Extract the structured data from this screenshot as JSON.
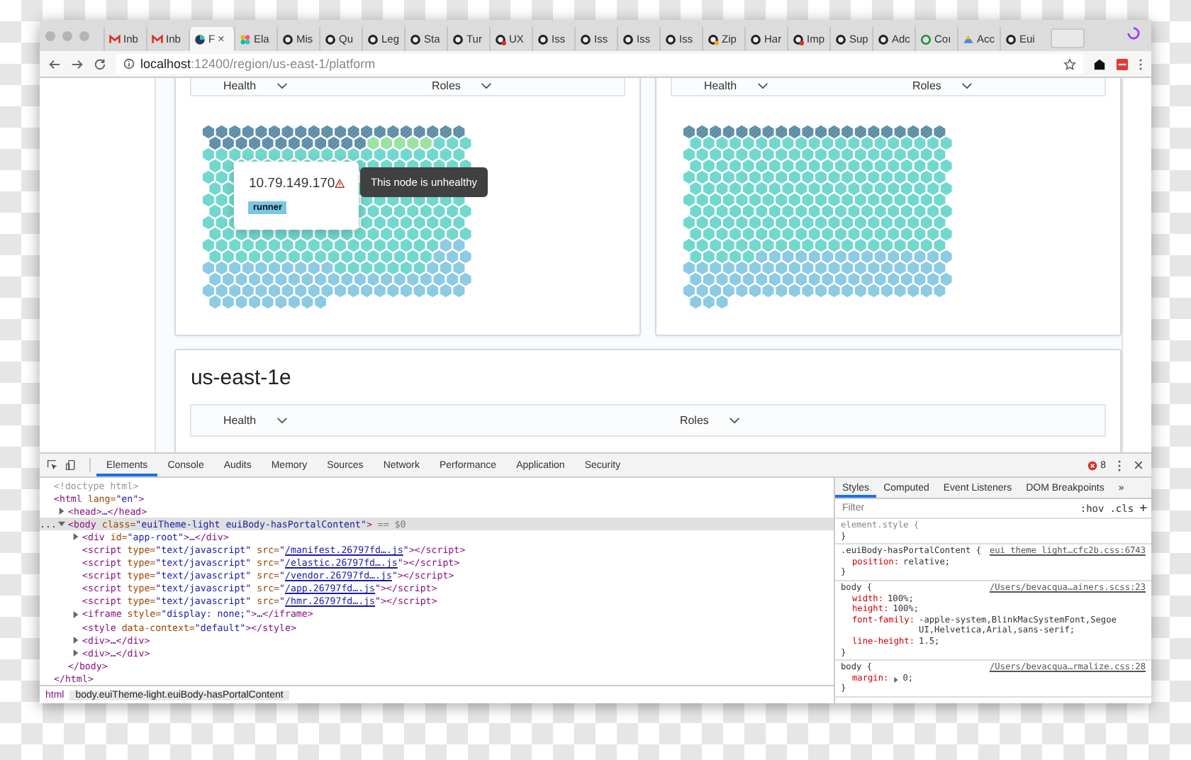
{
  "browser": {
    "tabs": [
      {
        "kind": "mail",
        "label": "Inb",
        "selected": false
      },
      {
        "kind": "mail",
        "label": "Inb",
        "selected": false
      },
      {
        "kind": "app",
        "label": "F",
        "selected": true,
        "close": "×"
      },
      {
        "kind": "elastic",
        "label": "Ela",
        "selected": false
      },
      {
        "kind": "github",
        "label": "Mis",
        "selected": false
      },
      {
        "kind": "github",
        "label": "Qu",
        "selected": false
      },
      {
        "kind": "github",
        "label": "Leg",
        "selected": false
      },
      {
        "kind": "github",
        "label": "Sta",
        "selected": false
      },
      {
        "kind": "github",
        "label": "Tur",
        "selected": false
      },
      {
        "kind": "github-error",
        "label": "UX",
        "selected": false
      },
      {
        "kind": "github",
        "label": "Iss",
        "selected": false
      },
      {
        "kind": "github",
        "label": "Iss",
        "selected": false
      },
      {
        "kind": "github",
        "label": "Iss",
        "selected": false
      },
      {
        "kind": "github",
        "label": "Iss",
        "selected": false
      },
      {
        "kind": "github-pending",
        "label": "Zip",
        "selected": false
      },
      {
        "kind": "github",
        "label": "Har",
        "selected": false
      },
      {
        "kind": "github-error",
        "label": "Imp",
        "selected": false
      },
      {
        "kind": "github",
        "label": "Sup",
        "selected": false
      },
      {
        "kind": "github",
        "label": "Adc",
        "selected": false
      },
      {
        "kind": "github-ok",
        "label": "Coı",
        "selected": false
      },
      {
        "kind": "drive",
        "label": "Acc",
        "selected": false
      },
      {
        "kind": "github",
        "label": "Eui",
        "selected": false
      }
    ],
    "address": {
      "host": "localhost",
      "path": ":12400/region/us-east-1/platform"
    }
  },
  "page": {
    "zones": [
      {
        "filters": [
          {
            "label": "Health"
          },
          {
            "label": "Roles"
          }
        ],
        "popover": {
          "ip": "10.79.149.170",
          "role": "runner",
          "tooltip": "This node is unhealthy"
        }
      },
      {
        "filters": [
          {
            "label": "Health"
          },
          {
            "label": "Roles"
          }
        ]
      }
    ],
    "section": {
      "title": "us-east-1e",
      "filters": [
        {
          "label": "Health"
        },
        {
          "label": "Roles"
        }
      ]
    }
  },
  "devtools": {
    "tabs": [
      {
        "label": "Elements",
        "selected": true
      },
      {
        "label": "Console",
        "selected": false
      },
      {
        "label": "Audits",
        "selected": false
      },
      {
        "label": "Memory",
        "selected": false
      },
      {
        "label": "Sources",
        "selected": false
      },
      {
        "label": "Network",
        "selected": false
      },
      {
        "label": "Performance",
        "selected": false
      },
      {
        "label": "Application",
        "selected": false
      },
      {
        "label": "Security",
        "selected": false
      }
    ],
    "error_count": "8",
    "dom": [
      {
        "text": "<!doctype html>",
        "kind": "doctype"
      },
      {
        "text": "<html lang=\"en\">",
        "close": "</html>",
        "children": [
          {
            "text": "<head>…</head>",
            "expanded": false
          },
          {
            "text": "<body class=\"euiTheme-light euiBody-hasPortalContent\">",
            "marker": "...",
            "suffix": "== $0",
            "selected": true,
            "expanded": true,
            "close": "</body>",
            "children": [
              {
                "text": "<div id=\"app-root\">…</div>",
                "expanded": false
              },
              {
                "text": "<script type=\"text/javascript\" src=\"",
                "link": "/manifest.26797fd….js",
                "after": "\"></script>"
              },
              {
                "text": "<script type=\"text/javascript\" src=\"",
                "link": "/elastic.26797fd….js",
                "after": "\"></script>"
              },
              {
                "text": "<script type=\"text/javascript\" src=\"",
                "link": "/vendor.26797fd….js",
                "after": "\"></script>"
              },
              {
                "text": "<script type=\"text/javascript\" src=\"",
                "link": "/app.26797fd….js",
                "after": "\"></script>"
              },
              {
                "text": "<script type=\"text/javascript\" src=\"",
                "link": "/hmr.26797fd….js",
                "after": "\"></script>"
              },
              {
                "text": "<iframe style=\"display: none;\">…</iframe>",
                "expanded": false
              },
              {
                "text": "<style data-context=\"default\"></style>"
              },
              {
                "text": "<div>…</div>",
                "expanded": false
              },
              {
                "text": "<div>…</div>",
                "expanded": false
              }
            ]
          }
        ]
      }
    ],
    "breadcrumbs": [
      {
        "label": "html",
        "selected": false
      },
      {
        "label": "body.euiTheme-light.euiBody-hasPortalContent",
        "selected": true
      }
    ],
    "styles": {
      "tabs": [
        {
          "label": "Styles",
          "selected": true
        },
        {
          "label": "Computed",
          "selected": false
        },
        {
          "label": "Event Listeners",
          "selected": false
        },
        {
          "label": "DOM Breakpoints",
          "selected": false
        }
      ],
      "more": "»",
      "filter": {
        "placeholder": "Filter"
      },
      "hov": ":hov",
      "cls": ".cls",
      "add": "+",
      "rules": [
        {
          "kind": "inline",
          "selector": "element.style {",
          "end": "}"
        },
        {
          "kind": "rule",
          "selector": ".euiBody-hasPortalContent {",
          "source": "eui_theme_light…cfc2b.css:6743",
          "end": "}",
          "decls": [
            {
              "prop": "position:",
              "value": "relative;"
            }
          ]
        },
        {
          "kind": "rule",
          "selector": "body {",
          "source": "/Users/bevacqua…ainers.scss:23",
          "end": "}",
          "decls": [
            {
              "prop": "width:",
              "value": "100%;"
            },
            {
              "prop": "height:",
              "value": "100%;"
            },
            {
              "prop": "font-family:",
              "value": "-apple-system,BlinkMacSystemFont,Segoe UI,Helvetica,Arial,sans-serif;"
            },
            {
              "prop": "line-height:",
              "value": "1.5;"
            }
          ]
        },
        {
          "kind": "rule",
          "selector": "body {",
          "source": "/Users/bevacqua…rmalize.css:28",
          "end": "}",
          "decls": [
            {
              "prop": "margin:",
              "value": "0;",
              "expandable": true
            }
          ]
        }
      ]
    }
  }
}
